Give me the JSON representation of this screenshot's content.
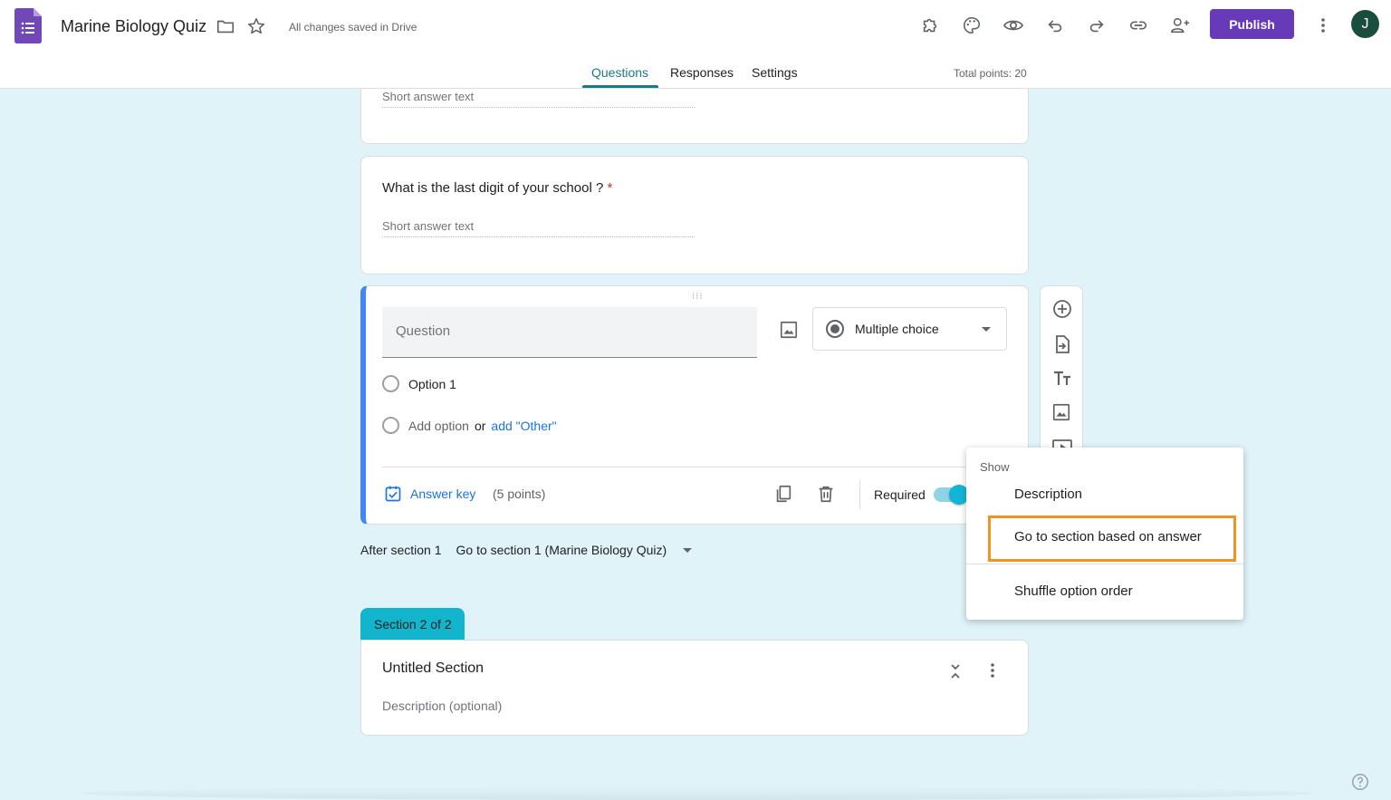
{
  "header": {
    "doc_title": "Marine Biology Quiz",
    "save_status": "All changes saved in Drive",
    "publish_label": "Publish",
    "avatar_initial": "J",
    "total_points": "Total points: 20"
  },
  "tabs": [
    {
      "label": "Questions",
      "active": true
    },
    {
      "label": "Responses",
      "active": false
    },
    {
      "label": "Settings",
      "active": false
    }
  ],
  "cards": {
    "prev_short_answer": "Short answer text",
    "school_question": {
      "title": "What is the last digit of your school ?",
      "required_marker": "*",
      "placeholder": "Short answer text"
    }
  },
  "active_question": {
    "placeholder": "Question",
    "type": "Multiple choice",
    "option1": "Option 1",
    "add_option": "Add option",
    "or": "or",
    "add_other": "add \"Other\"",
    "answer_key": "Answer key",
    "points": "(5 points)",
    "required": "Required",
    "required_on": true
  },
  "after_section": {
    "label": "After section 1",
    "goto": "Go to section 1 (Marine Biology Quiz)"
  },
  "section2": {
    "tab_label": "Section 2 of 2",
    "title": "Untitled Section",
    "description": "Description (optional)"
  },
  "menu": {
    "header": "Show",
    "items": [
      "Description",
      "Go to section based on answer",
      "Shuffle option order"
    ],
    "highlighted_index": 1,
    "highlight_color": "#f5921e"
  },
  "colors": {
    "brand_purple": "#673ab7",
    "accent_teal": "#1a7a8c",
    "section_cyan": "#12b5cb",
    "active_border": "#4285f4"
  }
}
